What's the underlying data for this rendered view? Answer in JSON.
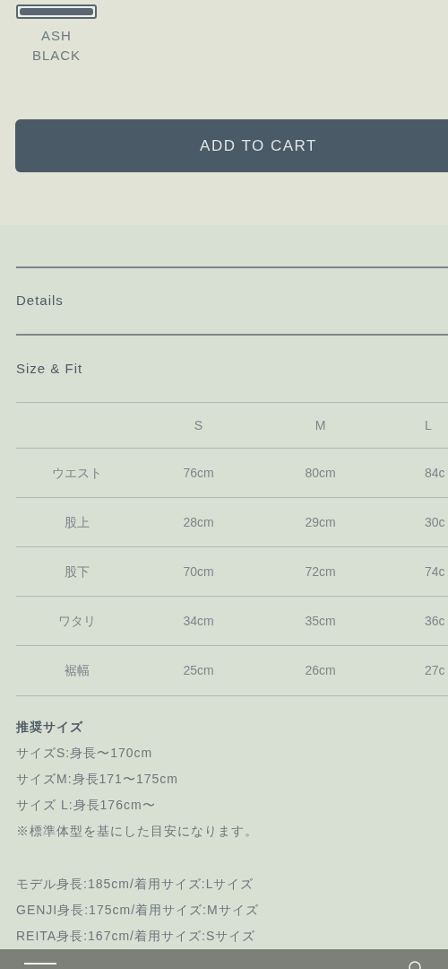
{
  "swatches": [
    {
      "label": "ASH\nBLACK",
      "color": "#5b6675",
      "selected": true
    }
  ],
  "add_to_cart": "ADD TO CART",
  "accordion": [
    {
      "label": "Details",
      "expanded": false
    },
    {
      "label": "Size & Fit",
      "expanded": true
    }
  ],
  "size_table": {
    "columns": [
      "",
      "S",
      "M",
      "L"
    ],
    "rows": [
      [
        "ウエスト",
        "76cm",
        "80cm",
        "84c"
      ],
      [
        "股上",
        "28cm",
        "29cm",
        "30c"
      ],
      [
        "股下",
        "70cm",
        "72cm",
        "74c"
      ],
      [
        "ワタリ",
        "34cm",
        "35cm",
        "36c"
      ],
      [
        "裾幅",
        "25cm",
        "26cm",
        "27c"
      ]
    ]
  },
  "recommended": {
    "title": "推奨サイズ",
    "lines": [
      "サイズS:身長〜170cm",
      "サイズM:身長171〜175cm",
      "サイズ L:身長176cm〜",
      "※標準体型を基にした目安になります。"
    ]
  },
  "models": [
    "モデル身長:185cm/着用サイズ:Lサイズ",
    "GENJI身長:175cm/着用サイズ:Mサイズ",
    "REITA身長:167cm/着用サイズ:Sサイズ"
  ]
}
